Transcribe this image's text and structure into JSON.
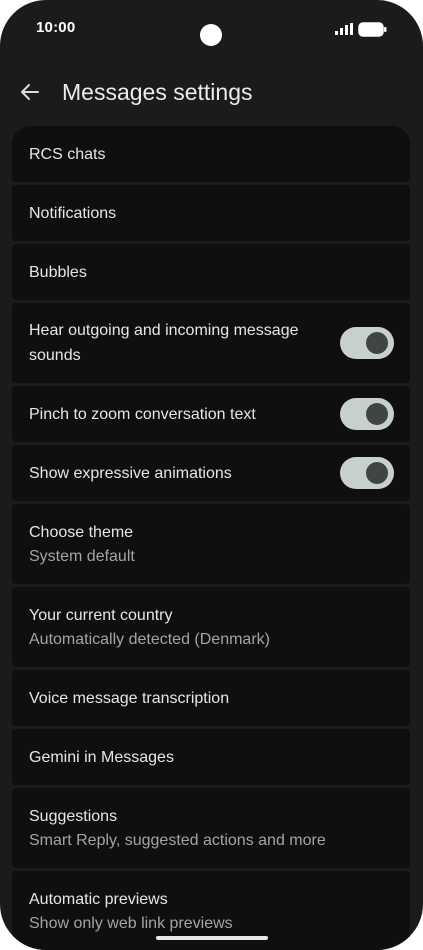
{
  "status_bar": {
    "time": "10:00"
  },
  "header": {
    "title": "Messages settings",
    "back_icon": "arrow-back-icon"
  },
  "settings": [
    {
      "title": "RCS chats"
    },
    {
      "title": "Notifications"
    },
    {
      "title": "Bubbles"
    },
    {
      "title": "Hear outgoing and incoming message sounds",
      "toggle": true
    },
    {
      "title": "Pinch to zoom conversation text",
      "toggle": true
    },
    {
      "title": "Show expressive animations",
      "toggle": true
    },
    {
      "title": "Choose theme",
      "subtitle": "System default"
    },
    {
      "title": "Your current country",
      "subtitle": "Automatically detected (Denmark)"
    },
    {
      "title": "Voice message transcription"
    },
    {
      "title": "Gemini in Messages"
    },
    {
      "title": "Suggestions",
      "subtitle": "Smart Reply, suggested actions and more"
    },
    {
      "title": "Automatic previews",
      "subtitle": "Show only web link previews"
    }
  ],
  "colors": {
    "background": "#1b1b1b",
    "row_background": "#0f0f0f",
    "toggle_track_on": "#c7d0cb",
    "toggle_thumb_on": "#3f4542"
  }
}
